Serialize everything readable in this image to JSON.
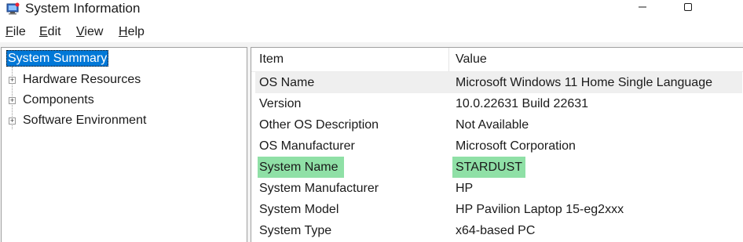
{
  "window": {
    "title": "System Information"
  },
  "menu": [
    {
      "accel": "F",
      "rest": "ile"
    },
    {
      "accel": "E",
      "rest": "dit"
    },
    {
      "accel": "V",
      "rest": "iew"
    },
    {
      "accel": "H",
      "rest": "elp"
    }
  ],
  "tree": {
    "root": "System Summary",
    "children": [
      "Hardware Resources",
      "Components",
      "Software Environment"
    ]
  },
  "table": {
    "headers": {
      "item": "Item",
      "value": "Value"
    },
    "rows": [
      {
        "item": "OS Name",
        "value": "Microsoft Windows 11 Home Single Language"
      },
      {
        "item": "Version",
        "value": "10.0.22631 Build 22631"
      },
      {
        "item": "Other OS Description",
        "value": "Not Available"
      },
      {
        "item": "OS Manufacturer",
        "value": "Microsoft Corporation"
      },
      {
        "item": "System Name",
        "value": "STARDUST"
      },
      {
        "item": "System Manufacturer",
        "value": "HP"
      },
      {
        "item": "System Model",
        "value": "HP Pavilion Laptop 15-eg2xxx"
      },
      {
        "item": "System Type",
        "value": "x64-based PC"
      }
    ]
  },
  "colors": {
    "selection": "#0078d7",
    "highlight": "#8fe0a6"
  },
  "icons": {
    "app": "system-information-icon",
    "minimize": "minimize-icon",
    "maximize": "maximize-icon"
  }
}
